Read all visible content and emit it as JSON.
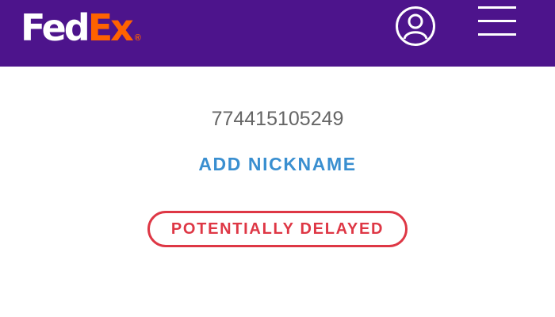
{
  "header": {
    "logo": {
      "part1": "Fed",
      "part2": "Ex",
      "registered": "®"
    },
    "account_icon": "user-circle-icon",
    "menu_icon": "hamburger-menu-icon",
    "background_color": "#4d148c"
  },
  "shipment": {
    "tracking_number": "774415105249",
    "add_nickname_label": "ADD NICKNAME",
    "status": "POTENTIALLY DELAYED"
  },
  "colors": {
    "brand_purple": "#4d148c",
    "brand_orange": "#ff6200",
    "link_blue": "#3a8fd0",
    "status_red": "#de3745",
    "tracking_gray": "#666666"
  }
}
